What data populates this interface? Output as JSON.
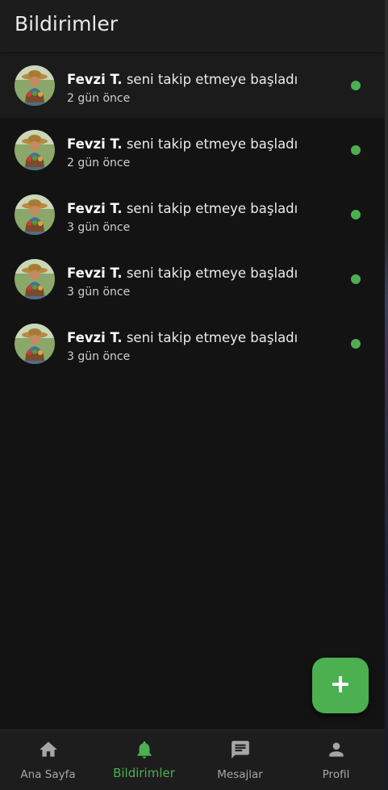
{
  "app_bar": {
    "title": "Bildirimler"
  },
  "notifications": [
    {
      "name": "Fevzi T.",
      "message": "seni takip etmeye başladı",
      "time": "2 gün önce"
    },
    {
      "name": "Fevzi T.",
      "message": "seni takip etmeye başladı",
      "time": "2 gün önce"
    },
    {
      "name": "Fevzi T.",
      "message": "seni takip etmeye başladı",
      "time": "3 gün önce"
    },
    {
      "name": "Fevzi T.",
      "message": "seni takip etmeye başladı",
      "time": "3 gün önce"
    },
    {
      "name": "Fevzi T.",
      "message": "seni takip etmeye başladı",
      "time": "3 gün önce"
    }
  ],
  "fab": {
    "icon": "plus-icon"
  },
  "bottom_nav": {
    "items": [
      {
        "label": "Ana Sayfa",
        "icon": "home-icon",
        "active": false
      },
      {
        "label": "Bildirimler",
        "icon": "bell-icon",
        "active": true
      },
      {
        "label": "Mesajlar",
        "icon": "chat-icon",
        "active": false
      },
      {
        "label": "Profil",
        "icon": "person-icon",
        "active": false
      }
    ]
  },
  "colors": {
    "accent": "#4caf50",
    "background": "#131313",
    "app_bar": "#1c1c1c",
    "unread_dot": "#4caf50"
  }
}
